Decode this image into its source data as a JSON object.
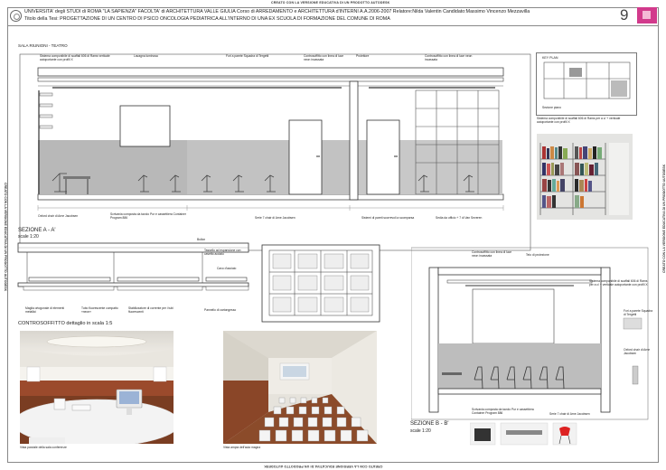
{
  "top_banner": "CREATO CON LA VERSIONE EDUCATIVA DI UN PRODOTTO AUTODESK",
  "bottom_banner": "CREATO CON LA VERSIONE EDUCATIVA DI UN PRODOTTO AUTODESK",
  "side_banner": "CREATO CON LA VERSIONE EDUCATIVA DI UN PRODOTTO AUTODESK",
  "header": {
    "line1": "UNIVERSITA' degli STUDI di ROMA \"LA SAPIENZA\" FACOLTA' di ARCHITETTURA VALLE GIULIA Corso di ARREDAMENTO e ARCHITETTURA d'INTERNI   A.A.2006-2007     Relatore:Nilda Valentin   Candidato:Massimo Vincenzo Mezzavilla",
    "line2": "Titolo della Tesi: PROGETTAZIONE DI UN CENTRO DI PSICO ONCOLOGIA PEDIATRICA ALL'INTERNO DI UNA EX SCUOLA DI FORMAZIONE DEL COMUNE DI ROMA",
    "sheet_number": "9"
  },
  "section_aa": {
    "room_label": "SALA RIUNIONI - TEATRO",
    "title": "SEZIONE A - A'",
    "scale": "scale 1:20",
    "notes_top": [
      "Sistema componibile di scaffali 606 di Rams verticale autoportante con profili X",
      "Lavagna luminosa",
      "Fori a parete Squadra di Tergetti",
      "Controsoffitto con linea di luce neon incassata",
      "Proiettore",
      "Controsoffitto con linea di luce neon incassata"
    ],
    "notes_bottom": [
      "Oxford chair di Arne Jacobsen",
      "Scrivania composta da tavolo Pur e cassettiera Container Program 886",
      "Serie 7 chair di Arne Jacobsen",
      "Sistemi di pareti scorrevoli a scomparsa",
      "Sedia da ufficio + 7 di Van Severen"
    ]
  },
  "key_plan": {
    "title": "KEY PLAN",
    "caption": "Sezione piano"
  },
  "bookshelf_note": "Sistema componibile di scaffali 606 di Rams per a c/ + verticale autoportante con profili X",
  "controsoffitto": {
    "title": "CONTROSOFFITTO dettaglio in scala 1:5",
    "notes": [
      "Bullon",
      "Tassello ad espansione con cavetto acciaio",
      "Cavo d'acciaio",
      "Maglia ortogonale di elementi metallici",
      "Tubo fluorescente compatto «neon»",
      "Stabilizzatore di corrente per i tubi fluorescenti",
      "Pannello di cartongesso"
    ]
  },
  "section_bb": {
    "title": "SEZIONE B - B'",
    "scale": "scale 1:20",
    "notes": [
      "Controsoffitto con linea di luce neon incassata",
      "Telo di proiezione",
      "Sistema componibile di scaffali 606 di Rams per a c/ + verticale autoportante con profili X",
      "Fori a parete Squadra di Tergetti",
      "Oxford chair di Arne Jacobsen",
      "Scrivania composta da tavolo Pur e cassettiera Container Program 886",
      "Serie 7 chair di Arne Jacobsen"
    ]
  },
  "renders": {
    "left_caption": "Vista parziale della sala conferenze",
    "right_caption": "Vista ampia dell'aula magna"
  }
}
